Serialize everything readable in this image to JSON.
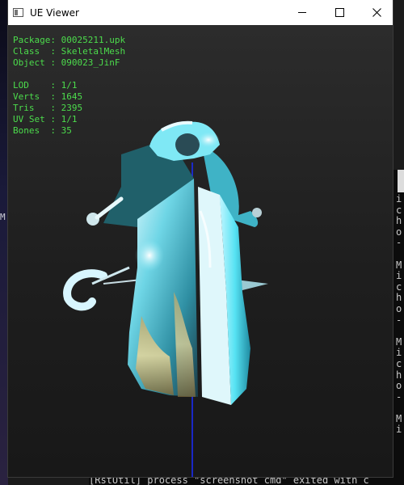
{
  "window": {
    "title": "UE Viewer",
    "buttons": [
      "minimize",
      "maximize",
      "close"
    ]
  },
  "info": {
    "package": "Package: 00025211.upk",
    "class": "Class  : SkeletalMesh",
    "object": "Object : 090023_JinF"
  },
  "stats": {
    "lod": "LOD    : 1/1",
    "verts": "Verts  : 1645",
    "tris": "Tris   : 2395",
    "uv_set": "UV Set : 1/1",
    "bones": "Bones  : 35"
  },
  "background": {
    "left_char": "M",
    "console_right_lines": [
      "i",
      "c",
      "h",
      "o",
      "-",
      "",
      "M",
      "i",
      "c",
      "h",
      "o",
      "-",
      "",
      "M",
      "i",
      "c",
      "h",
      "o",
      "-",
      "",
      "M",
      "i"
    ],
    "console_bottom": "[RstUtil] process \"screenshot cmd\" exited with c"
  },
  "colors": {
    "overlay_text": "#4cdc4c",
    "mesh_cyan": "#5fe3f0",
    "axis_line": "#1a2cff"
  }
}
